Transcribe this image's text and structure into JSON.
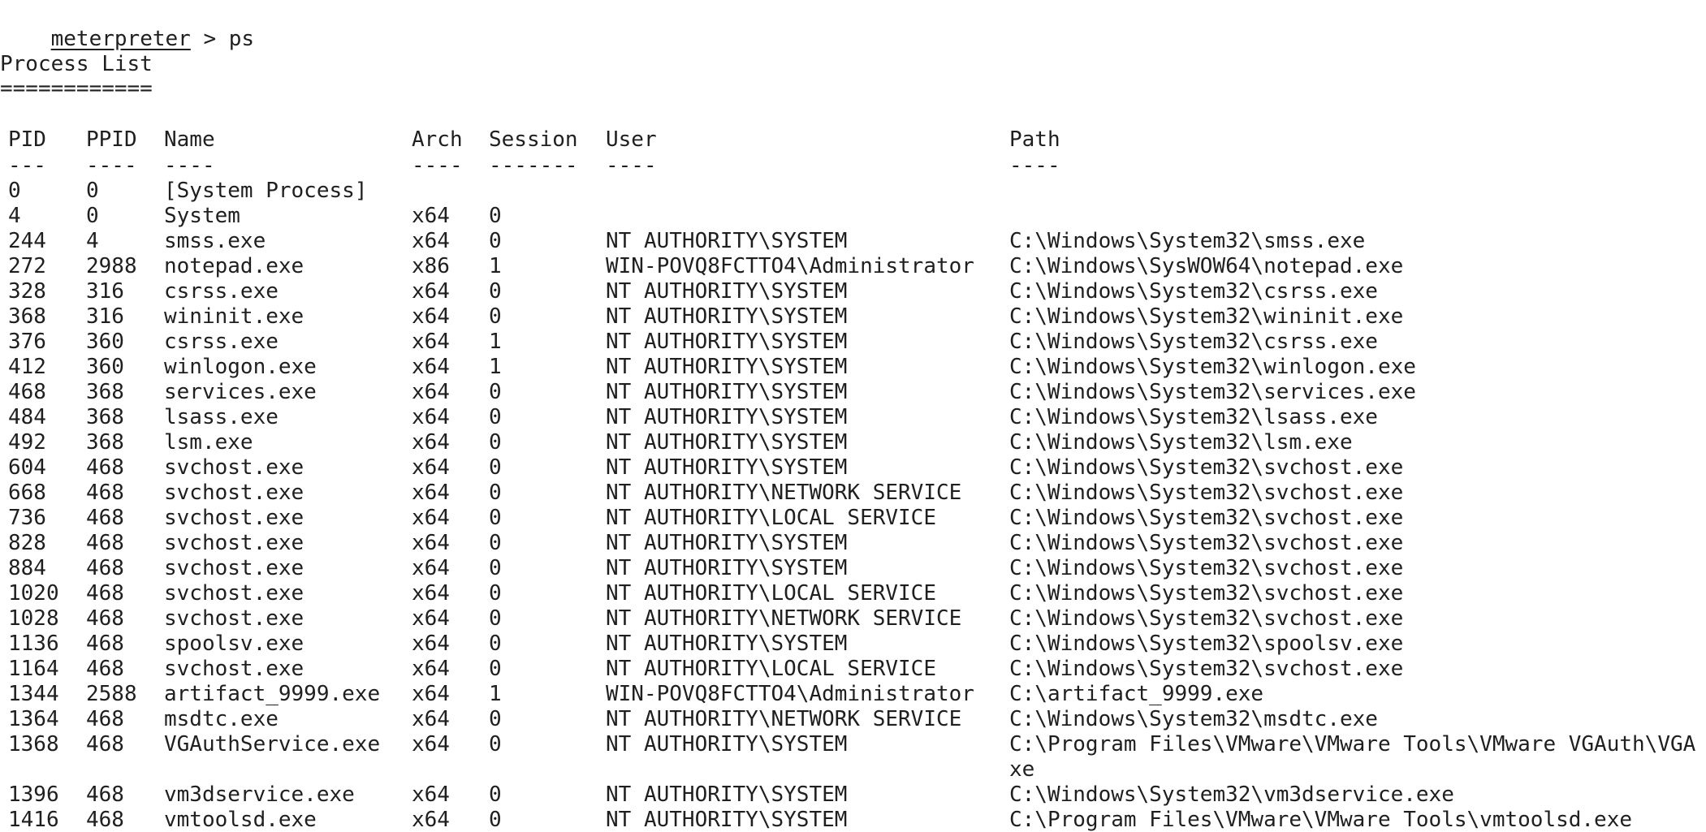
{
  "terminal": {
    "prompt": "meterpreter",
    "prompt_sep": " > ",
    "command": "ps",
    "section_title": "Process List",
    "title_rule": "============",
    "columns": {
      "pid": "PID",
      "ppid": "PPID",
      "name": "Name",
      "arch": "Arch",
      "session": "Session",
      "user": "User",
      "path": "Path"
    },
    "dashes": {
      "pid": "---",
      "ppid": "----",
      "name": "----",
      "arch": "----",
      "session": "-------",
      "user": "----",
      "path": "----"
    },
    "rows": [
      {
        "pid": "0",
        "ppid": "0",
        "name": "[System Process]",
        "arch": "",
        "session": "",
        "user": "",
        "path": ""
      },
      {
        "pid": "4",
        "ppid": "0",
        "name": "System",
        "arch": "x64",
        "session": "0",
        "user": "",
        "path": ""
      },
      {
        "pid": "244",
        "ppid": "4",
        "name": "smss.exe",
        "arch": "x64",
        "session": "0",
        "user": "NT AUTHORITY\\SYSTEM",
        "path": "C:\\Windows\\System32\\smss.exe"
      },
      {
        "pid": "272",
        "ppid": "2988",
        "name": "notepad.exe",
        "arch": "x86",
        "session": "1",
        "user": "WIN-POVQ8FCTTO4\\Administrator",
        "path": "C:\\Windows\\SysWOW64\\notepad.exe"
      },
      {
        "pid": "328",
        "ppid": "316",
        "name": "csrss.exe",
        "arch": "x64",
        "session": "0",
        "user": "NT AUTHORITY\\SYSTEM",
        "path": "C:\\Windows\\System32\\csrss.exe"
      },
      {
        "pid": "368",
        "ppid": "316",
        "name": "wininit.exe",
        "arch": "x64",
        "session": "0",
        "user": "NT AUTHORITY\\SYSTEM",
        "path": "C:\\Windows\\System32\\wininit.exe"
      },
      {
        "pid": "376",
        "ppid": "360",
        "name": "csrss.exe",
        "arch": "x64",
        "session": "1",
        "user": "NT AUTHORITY\\SYSTEM",
        "path": "C:\\Windows\\System32\\csrss.exe"
      },
      {
        "pid": "412",
        "ppid": "360",
        "name": "winlogon.exe",
        "arch": "x64",
        "session": "1",
        "user": "NT AUTHORITY\\SYSTEM",
        "path": "C:\\Windows\\System32\\winlogon.exe"
      },
      {
        "pid": "468",
        "ppid": "368",
        "name": "services.exe",
        "arch": "x64",
        "session": "0",
        "user": "NT AUTHORITY\\SYSTEM",
        "path": "C:\\Windows\\System32\\services.exe"
      },
      {
        "pid": "484",
        "ppid": "368",
        "name": "lsass.exe",
        "arch": "x64",
        "session": "0",
        "user": "NT AUTHORITY\\SYSTEM",
        "path": "C:\\Windows\\System32\\lsass.exe"
      },
      {
        "pid": "492",
        "ppid": "368",
        "name": "lsm.exe",
        "arch": "x64",
        "session": "0",
        "user": "NT AUTHORITY\\SYSTEM",
        "path": "C:\\Windows\\System32\\lsm.exe"
      },
      {
        "pid": "604",
        "ppid": "468",
        "name": "svchost.exe",
        "arch": "x64",
        "session": "0",
        "user": "NT AUTHORITY\\SYSTEM",
        "path": "C:\\Windows\\System32\\svchost.exe"
      },
      {
        "pid": "668",
        "ppid": "468",
        "name": "svchost.exe",
        "arch": "x64",
        "session": "0",
        "user": "NT AUTHORITY\\NETWORK SERVICE",
        "path": "C:\\Windows\\System32\\svchost.exe"
      },
      {
        "pid": "736",
        "ppid": "468",
        "name": "svchost.exe",
        "arch": "x64",
        "session": "0",
        "user": "NT AUTHORITY\\LOCAL SERVICE",
        "path": "C:\\Windows\\System32\\svchost.exe"
      },
      {
        "pid": "828",
        "ppid": "468",
        "name": "svchost.exe",
        "arch": "x64",
        "session": "0",
        "user": "NT AUTHORITY\\SYSTEM",
        "path": "C:\\Windows\\System32\\svchost.exe"
      },
      {
        "pid": "884",
        "ppid": "468",
        "name": "svchost.exe",
        "arch": "x64",
        "session": "0",
        "user": "NT AUTHORITY\\SYSTEM",
        "path": "C:\\Windows\\System32\\svchost.exe"
      },
      {
        "pid": "1020",
        "ppid": "468",
        "name": "svchost.exe",
        "arch": "x64",
        "session": "0",
        "user": "NT AUTHORITY\\LOCAL SERVICE",
        "path": "C:\\Windows\\System32\\svchost.exe"
      },
      {
        "pid": "1028",
        "ppid": "468",
        "name": "svchost.exe",
        "arch": "x64",
        "session": "0",
        "user": "NT AUTHORITY\\NETWORK SERVICE",
        "path": "C:\\Windows\\System32\\svchost.exe"
      },
      {
        "pid": "1136",
        "ppid": "468",
        "name": "spoolsv.exe",
        "arch": "x64",
        "session": "0",
        "user": "NT AUTHORITY\\SYSTEM",
        "path": "C:\\Windows\\System32\\spoolsv.exe"
      },
      {
        "pid": "1164",
        "ppid": "468",
        "name": "svchost.exe",
        "arch": "x64",
        "session": "0",
        "user": "NT AUTHORITY\\LOCAL SERVICE",
        "path": "C:\\Windows\\System32\\svchost.exe"
      },
      {
        "pid": "1344",
        "ppid": "2588",
        "name": "artifact_9999.exe",
        "arch": "x64",
        "session": "1",
        "user": "WIN-POVQ8FCTTO4\\Administrator",
        "path": "C:\\artifact_9999.exe"
      },
      {
        "pid": "1364",
        "ppid": "468",
        "name": "msdtc.exe",
        "arch": "x64",
        "session": "0",
        "user": "NT AUTHORITY\\NETWORK SERVICE",
        "path": "C:\\Windows\\System32\\msdtc.exe"
      },
      {
        "pid": "1368",
        "ppid": "468",
        "name": "VGAuthService.exe",
        "arch": "x64",
        "session": "0",
        "user": "NT AUTHORITY\\SYSTEM",
        "path": "C:\\Program Files\\VMware\\VMware Tools\\VMware VGAuth\\VGA",
        "path_wrap": "xe"
      },
      {
        "pid": "1396",
        "ppid": "468",
        "name": "vm3dservice.exe",
        "arch": "x64",
        "session": "0",
        "user": "NT AUTHORITY\\SYSTEM",
        "path": "C:\\Windows\\System32\\vm3dservice.exe"
      },
      {
        "pid": "1416",
        "ppid": "468",
        "name": "vmtoolsd.exe",
        "arch": "x64",
        "session": "0",
        "user": "NT AUTHORITY\\SYSTEM",
        "path": "C:\\Program Files\\VMware\\VMware Tools\\vmtoolsd.exe"
      }
    ]
  }
}
